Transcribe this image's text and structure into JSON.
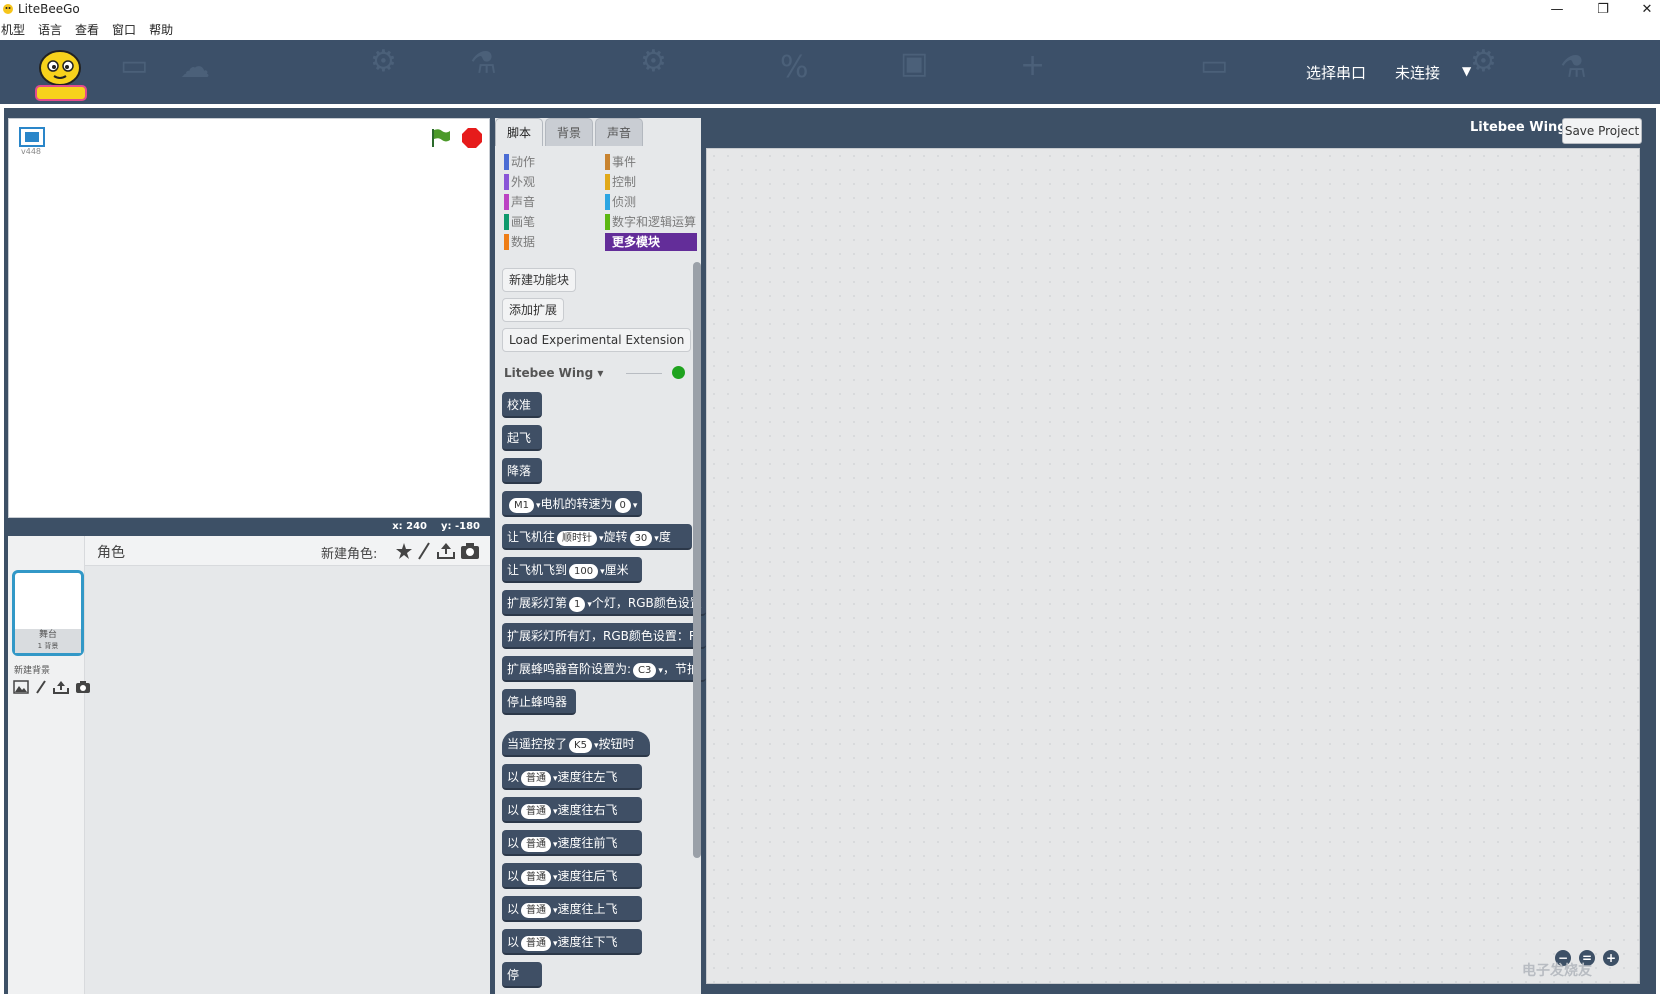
{
  "window": {
    "title": "LiteBeeGo",
    "min": "—",
    "restore": "❐",
    "close": "✕"
  },
  "menu": [
    "机型",
    "语言",
    "查看",
    "窗口",
    "帮助"
  ],
  "banner": {
    "serial": "选择串口",
    "status": "未连接",
    "dropdown": "▼"
  },
  "stage": {
    "version": "v448",
    "x_label": "x:",
    "x_value": "240",
    "y_label": "y:",
    "y_value": "-180"
  },
  "sprites": {
    "header": "角色",
    "new_sprite": "新建角色:",
    "stage_tile_name": "舞台",
    "stage_tile_sub": "1 背景",
    "new_backdrop": "新建背景"
  },
  "tabs": [
    "脚本",
    "背景",
    "声音"
  ],
  "categories_left": [
    {
      "label": "动作",
      "color": "#4a6cd4"
    },
    {
      "label": "外观",
      "color": "#8a55d7"
    },
    {
      "label": "声音",
      "color": "#bb42c3"
    },
    {
      "label": "画笔",
      "color": "#0e9a6c"
    },
    {
      "label": "数据",
      "color": "#ee7d16"
    }
  ],
  "categories_right": [
    {
      "label": "事件",
      "color": "#c88330"
    },
    {
      "label": "控制",
      "color": "#e1a91a"
    },
    {
      "label": "侦测",
      "color": "#2ca5e2"
    },
    {
      "label": "数字和逻辑运算",
      "color": "#5cb712"
    },
    {
      "label": "更多模块",
      "color": "#632d99"
    }
  ],
  "palette_buttons": {
    "new_block": "新建功能块",
    "add_ext": "添加扩展",
    "load_exp": "Load Experimental Extension"
  },
  "extension": {
    "name": "Litebee Wing",
    "status_color": "#1fa31f"
  },
  "blocks": [
    {
      "text": "校准"
    },
    {
      "text": "起飞"
    },
    {
      "text": "降落"
    },
    {
      "pre": "",
      "pill1": "M1",
      "mid": "电机的转速为",
      "pill2": "0",
      "post": ""
    },
    {
      "pre": "让飞机往",
      "pill1": "顺时针",
      "mid": "旋转",
      "pill2": "30",
      "post": "度"
    },
    {
      "pre": "让飞机飞到",
      "pill1": "100",
      "mid": "厘米",
      "pill2": "",
      "post": ""
    },
    {
      "pre": "扩展彩灯第",
      "pill1": "1",
      "mid": "个灯，RGB颜色设置",
      "pill2": "",
      "post": ""
    },
    {
      "text": "扩展彩灯所有灯，RGB颜色设置：R"
    },
    {
      "pre": "扩展蜂鸣器音阶设置为:",
      "pill1": "C3",
      "mid": "，节拍",
      "pill2": "",
      "post": ""
    },
    {
      "text": "停止蜂鸣器"
    },
    {
      "pre": "当遥控按了",
      "pill1": "K5",
      "mid": "按钮时",
      "pill2": "",
      "post": ""
    },
    {
      "pre": "以",
      "pill1": "普通",
      "mid": "速度往左飞",
      "pill2": "",
      "post": ""
    },
    {
      "pre": "以",
      "pill1": "普通",
      "mid": "速度往右飞",
      "pill2": "",
      "post": ""
    },
    {
      "pre": "以",
      "pill1": "普通",
      "mid": "速度往前飞",
      "pill2": "",
      "post": ""
    },
    {
      "pre": "以",
      "pill1": "普通",
      "mid": "速度往后飞",
      "pill2": "",
      "post": ""
    },
    {
      "pre": "以",
      "pill1": "普通",
      "mid": "速度往上飞",
      "pill2": "",
      "post": ""
    },
    {
      "pre": "以",
      "pill1": "普通",
      "mid": "速度往下飞",
      "pill2": "",
      "post": ""
    },
    {
      "text": "停"
    }
  ],
  "save_project": "Save Project",
  "zoom": {
    "out": "−",
    "reset": "=",
    "in": "+"
  },
  "watermark": "电子发烧友"
}
